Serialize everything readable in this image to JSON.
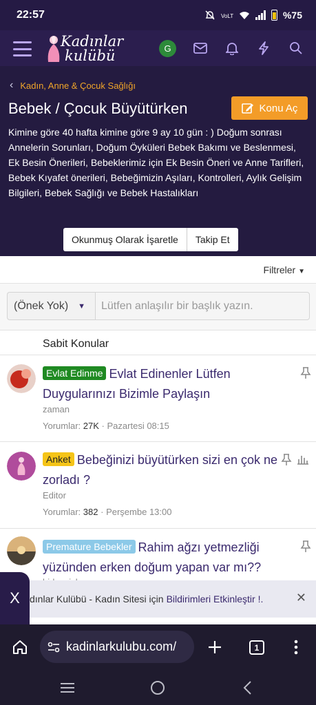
{
  "status": {
    "time": "22:57",
    "battery": "%75"
  },
  "header": {
    "logo_line1": "Kadınlar",
    "logo_line2": "kulübü",
    "avatar_letter": "G"
  },
  "forum": {
    "breadcrumb": "Kadın, Anne & Çocuk Sağlığı",
    "title": "Bebek / Çocuk Büyütürken",
    "new_thread_label": "Konu Aç",
    "description": "Kimine göre 40 hafta kimine göre 9 ay 10 gün : ) Doğum sonrası Annelerin Sorunları, Doğum Öyküleri Bebek Bakımı ve Beslenmesi, Ek Besin Önerileri, Bebeklerimiz için Ek Besin Öneri ve Anne Tarifleri, Bebek Kıyafet önerileri, Bebeğimizin Aşıları, Kontrolleri, Aylık Gelişim Bilgileri, Bebek Sağlığı ve Bebek Hastalıkları",
    "mark_read_label": "Okunmuş Olarak İşaretle",
    "follow_label": "Takip Et"
  },
  "filters_label": "Filtreler",
  "quick_thread": {
    "prefix": "(Önek Yok)",
    "placeholder": "Lütfen anlaşılır bir başlık yazın."
  },
  "sticky_header": "Sabit Konular",
  "threads": [
    {
      "label": "Evlat Edinme",
      "label_color": "#1f8a22",
      "title": "Evlat Edinenler Lütfen Duygularınızı Bizimle Paylaşın",
      "author": "zaman",
      "replies_label": "Yorumlar:",
      "replies": "27K",
      "date": "Pazartesi 08:15"
    },
    {
      "label": "Anket",
      "label_color": "#f5c418",
      "title": "Bebeğinizi büyütürken sizi en çok ne zorladı ?",
      "author": "Editor",
      "replies_label": "Yorumlar:",
      "replies": "382",
      "date": "Perşembe 13:00"
    },
    {
      "label": "Premature Bebekler",
      "label_color": "#8cc9e8",
      "title": "Rahim ağzı yetmezliği yüzünden erken doğum yapan var mı??",
      "author": "bidvnnisko"
    }
  ],
  "notification": {
    "text": "dınlar Kulübü - Kadın Sitesi için",
    "link": "Bildirimleri Etkinleştir !.",
    "close": "✕",
    "x_tab": "X"
  },
  "browser": {
    "url": "kadinlarkulubu.com/",
    "tab_count": "1"
  }
}
